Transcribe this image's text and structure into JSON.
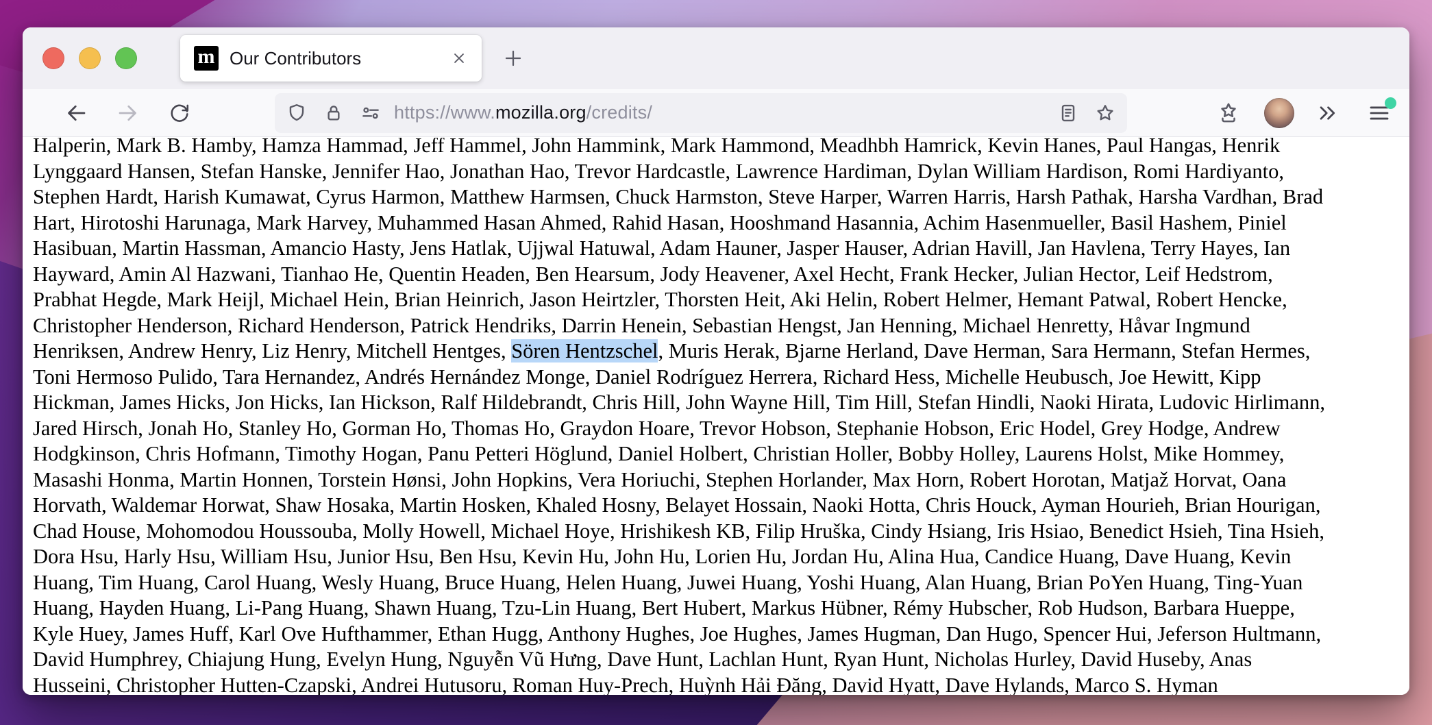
{
  "tab": {
    "title": "Our Contributors",
    "favicon_letter": "m"
  },
  "toolbar": {
    "url": {
      "prefix": "https://www.",
      "domain": "mozilla.org",
      "path": "/credits/"
    }
  },
  "colors": {
    "selection_highlight": "#b8d7f8",
    "menu_badge_green": "#3fd4a4",
    "traffic_red": "#ee6a5f",
    "traffic_yellow": "#f5bf4f",
    "traffic_green": "#62c454",
    "urlbar_background": "#f0f0f4",
    "toolbar_background": "#f9f9fb",
    "tabbar_background": "#f0eff4"
  },
  "content": {
    "highlight": "Sören Hentzschel",
    "lines": [
      "Halperin, Mark B. Hamby, Hamza Hammad, Jeff Hammel, John Hammink, Mark Hammond, Meadhbh Hamrick, Kevin Hanes, Paul Hangas, Henrik",
      "Lynggaard Hansen, Stefan Hanske, Jennifer Hao, Jonathan Hao, Trevor Hardcastle, Lawrence Hardiman, Dylan William Hardison, Romi Hardiyanto,",
      "Stephen Hardt, Harish Kumawat, Cyrus Harmon, Matthew Harmsen, Chuck Harmston, Steve Harper, Warren Harris, Harsh Pathak, Harsha Vardhan, Brad",
      "Hart, Hirotoshi Harunaga, Mark Harvey, Muhammed Hasan Ahmed, Rahid Hasan, Hooshmand Hasannia, Achim Hasenmueller, Basil Hashem, Piniel",
      "Hasibuan, Martin Hassman, Amancio Hasty, Jens Hatlak, Ujjwal Hatuwal, Adam Hauner, Jasper Hauser, Adrian Havill, Jan Havlena, Terry Hayes, Ian",
      "Hayward, Amin Al Hazwani, Tianhao He, Quentin Headen, Ben Hearsum, Jody Heavener, Axel Hecht, Frank Hecker, Julian Hector, Leif Hedstrom,",
      "Prabhat Hegde, Mark Heijl, Michael Hein, Brian Heinrich, Jason Heirtzler, Thorsten Heit, Aki Helin, Robert Helmer, Hemant Patwal, Robert Hencke,",
      "Christopher Henderson, Richard Henderson, Patrick Hendriks, Darrin Henein, Sebastian Hengst, Jan Henning, Michael Henretty, Håvar Ingmund",
      "Henriksen, Andrew Henry, Liz Henry, Mitchell Hentges, Sören Hentzschel, Muris Herak, Bjarne Herland, Dave Herman, Sara Hermann, Stefan Hermes,",
      "Toni Hermoso Pulido, Tara Hernandez, Andrés Hernández Monge, Daniel Rodríguez Herrera, Richard Hess, Michelle Heubusch, Joe Hewitt, Kipp",
      "Hickman, James Hicks, Jon Hicks, Ian Hickson, Ralf Hildebrandt, Chris Hill, John Wayne Hill, Tim Hill, Stefan Hindli, Naoki Hirata, Ludovic Hirlimann,",
      "Jared Hirsch, Jonah Ho, Stanley Ho, Gorman Ho, Thomas Ho, Graydon Hoare, Trevor Hobson, Stephanie Hobson, Eric Hodel, Grey Hodge, Andrew",
      "Hodgkinson, Chris Hofmann, Timothy Hogan, Panu Petteri Höglund, Daniel Holbert, Christian Holler, Bobby Holley, Laurens Holst, Mike Hommey,",
      "Masashi Honma, Martin Honnen, Torstein Hønsi, John Hopkins, Vera Horiuchi, Stephen Horlander, Max Horn, Robert Horotan, Matjaž Horvat, Oana",
      "Horvath, Waldemar Horwat, Shaw Hosaka, Martin Hosken, Khaled Hosny, Belayet Hossain, Naoki Hotta, Chris Houck, Ayman Hourieh, Brian Hourigan,",
      "Chad House, Mohomodou Houssouba, Molly Howell, Michael Hoye, Hrishikesh KB, Filip Hruška, Cindy Hsiang, Iris Hsiao, Benedict Hsieh, Tina Hsieh,",
      "Dora Hsu, Harly Hsu, William Hsu, Junior Hsu, Ben Hsu, Kevin Hu, John Hu, Lorien Hu, Jordan Hu, Alina Hua, Candice Huang, Dave Huang, Kevin",
      "Huang, Tim Huang, Carol Huang, Wesly Huang, Bruce Huang, Helen Huang, Juwei Huang, Yoshi Huang, Alan Huang, Brian PoYen Huang, Ting-Yuan",
      "Huang, Hayden Huang, Li-Pang Huang, Shawn Huang, Tzu-Lin Huang, Bert Hubert, Markus Hübner, Rémy Hubscher, Rob Hudson, Barbara Hueppe,",
      "Kyle Huey, James Huff, Karl Ove Hufthammer, Ethan Hugg, Anthony Hughes, Joe Hughes, James Hugman, Dan Hugo, Spencer Hui, Jeferson Hultmann,",
      "David Humphrey, Chiajung Hung, Evelyn Hung, Nguyễn Vũ Hưng, Dave Hunt, Lachlan Hunt, Ryan Hunt, Nicholas Hurley, David Huseby, Anas",
      "Husseini, Christopher Hutten-Czapski, Andrei Hutusoru, Roman Huy-Prech, Huỳnh Hải Đăng, David Hyatt, Dave Hylands, Marco S. Hyman"
    ]
  }
}
